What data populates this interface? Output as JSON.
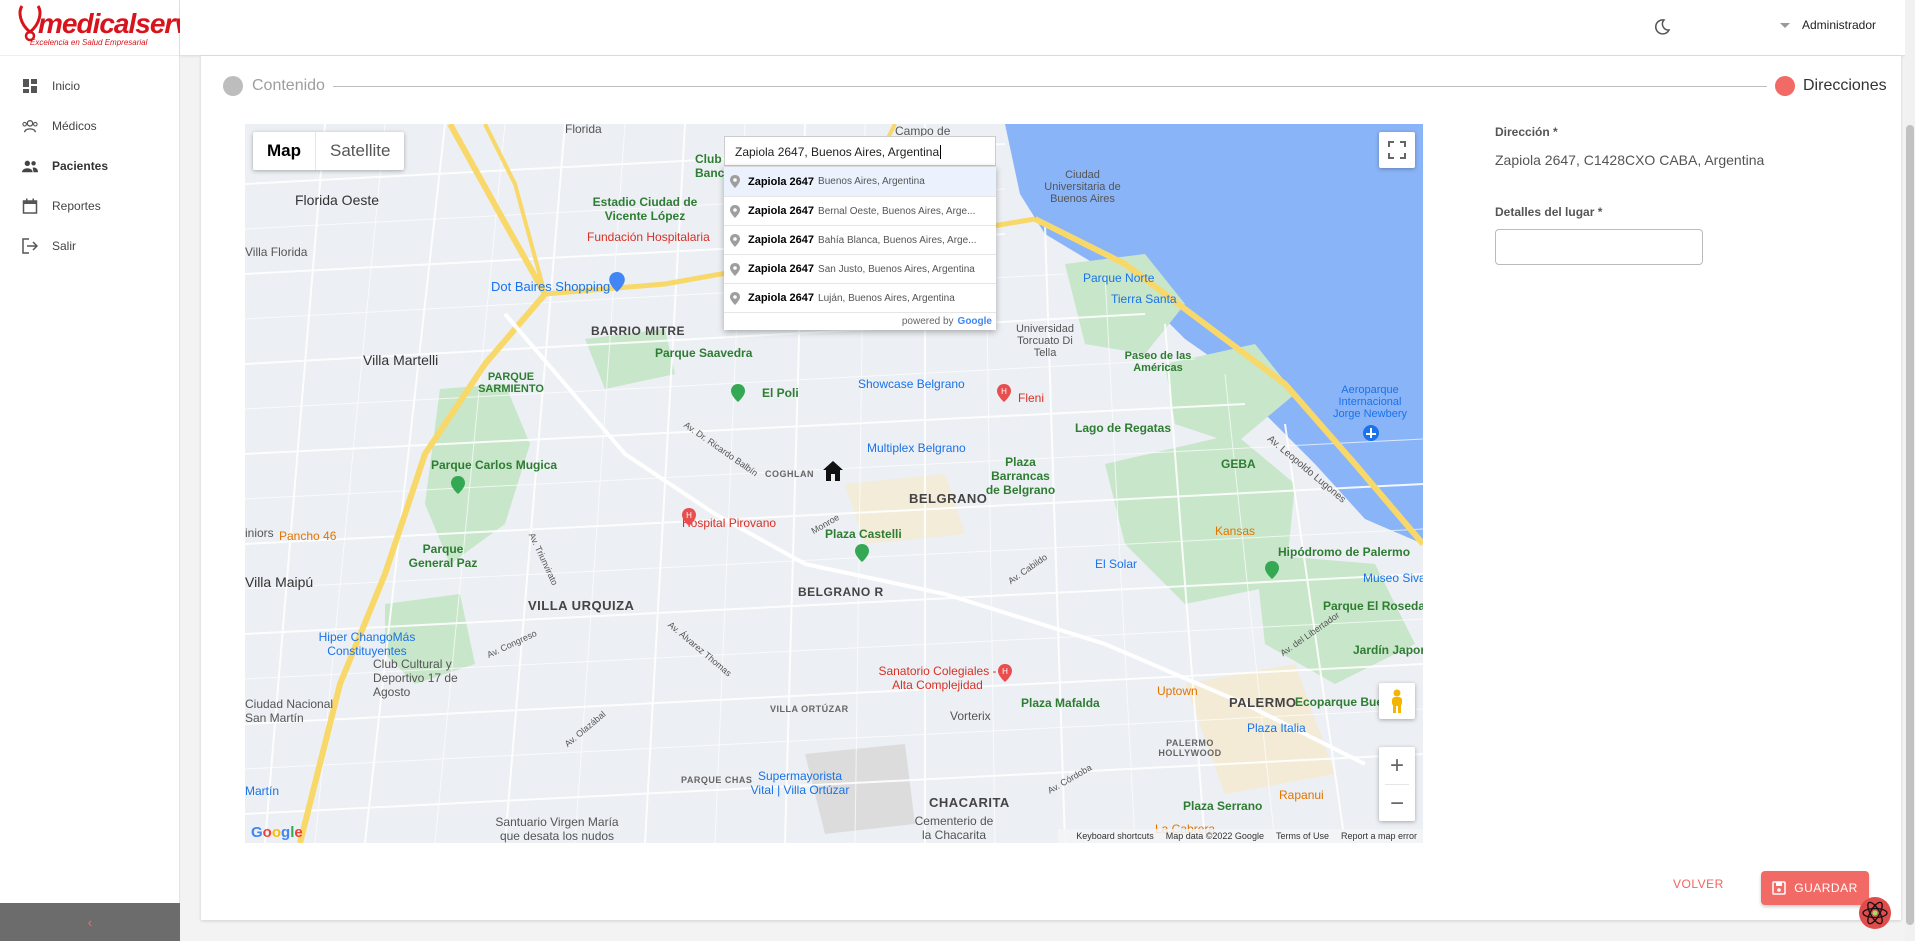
{
  "brand": {
    "name": "medicalservice",
    "tagline": "Excelencia en Salud Empresarial"
  },
  "sidebar": {
    "items": [
      {
        "label": "Inicio",
        "icon": "dashboard-icon"
      },
      {
        "label": "Médicos",
        "icon": "doctors-icon"
      },
      {
        "label": "Pacientes",
        "icon": "patients-icon",
        "active": true
      },
      {
        "label": "Reportes",
        "icon": "calendar-icon"
      },
      {
        "label": "Salir",
        "icon": "logout-icon"
      }
    ],
    "collapse_glyph": "‹"
  },
  "topbar": {
    "user": "Administrador",
    "theme_icon": "moon-icon"
  },
  "stepper": {
    "steps": [
      {
        "label": "Contenido",
        "color": "#bdbdbd"
      },
      {
        "label": "Direcciones",
        "color": "#f26a66"
      }
    ]
  },
  "map": {
    "type_control": {
      "map": "Map",
      "satellite": "Satellite"
    },
    "search_value": "Zapiola 2647, Buenos Aires, Argentina",
    "suggestions": [
      {
        "main": "Zapiola 2647",
        "secondary": "Buenos Aires, Argentina"
      },
      {
        "main": "Zapiola 2647",
        "secondary": "Bernal Oeste, Buenos Aires, Arge..."
      },
      {
        "main": "Zapiola 2647",
        "secondary": "Bahía Blanca, Buenos Aires, Arge..."
      },
      {
        "main": "Zapiola 2647",
        "secondary": "San Justo, Buenos Aires, Argentina"
      },
      {
        "main": "Zapiola 2647",
        "secondary": "Luján, Buenos Aires, Argentina"
      }
    ],
    "powered_by": "powered by",
    "google": "Google",
    "footer": {
      "shortcuts": "Keyboard shortcuts",
      "data": "Map data ©2022 Google",
      "terms": "Terms of Use",
      "report": "Report a map error"
    },
    "labels": {
      "florida": "Florida",
      "florida_oeste": "Florida Oeste",
      "villa_florida": "Villa Florida",
      "villa_martelli": "Villa Martelli",
      "villa_maipu": "Villa Maipú",
      "barrio_mitre": "BARRIO MITRE",
      "parque_sarmiento": "PARQUE SARMIENTO",
      "parque_saavedra": "Parque Saavedra",
      "parque_carlos_mugica": "Parque Carlos Mugica",
      "parque_general_paz": "Parque General Paz",
      "dot_baires": "Dot Baires Shopping",
      "estadio": "Estadio Ciudad de Vicente López",
      "fundacion": "Fundación Hospitalaria",
      "campo": "Campo de",
      "club": "Club Banco",
      "ciudad_universitaria": "Ciudad Universitaria de Buenos Aires",
      "parque_norte": "Parque Norte",
      "tierra_santa": "Tierra Santa",
      "universidad": "Universidad Torcuato Di Tella",
      "paseo_americas": "Paseo de las Américas",
      "aeroparque": "Aeroparque Internacional Jorge Newbery",
      "el_poli": "El Poli",
      "showcase": "Showcase Belgrano",
      "fleni": "Fleni",
      "lago_regatas": "Lago de Regatas",
      "geba": "GEBA",
      "multiplex": "Multiplex Belgrano",
      "coghlan": "COGHLAN",
      "belgrano": "BELGRANO",
      "plaza_barrancas": "Plaza Barrancas de Belgrano",
      "hospital_pirovano": "Hospital Pirovano",
      "plaza_castelli": "Plaza Castelli",
      "kansas": "Kansas",
      "hipodromo": "Hipódromo de Palermo",
      "museo": "Museo Siva",
      "parque_rosedal": "Parque El Rosedal",
      "jardin_japones": "Jardín Japon",
      "pancho": "Pancho 46",
      "villa_urquiza": "VILLA URQUIZA",
      "belgrano_r": "BELGRANO R",
      "el_solar": "El Solar",
      "hiper_chango": "Hiper ChangoMás Constituyentes",
      "sanatorio": "Sanatorio Colegiales - Alta Complejidad",
      "uptown": "Uptown",
      "palermo": "PALERMO",
      "ecoparque": "Ecoparque Bue",
      "club_cultural": "Club Cultural y Deportivo 17 de Agosto",
      "villa_ortuzar": "VILLA ORTÚZAR",
      "vorterix": "Vorterix",
      "plaza_mafalda": "Plaza Mafalda",
      "plaza_italia": "Plaza Italia",
      "palermo_hollywood": "PALERMO HOLLYWOOD",
      "ciudad_nacional": "Ciudad Nacional San Martín",
      "parque_chas": "PARQUE CHAS",
      "supermayorista": "Supermayorista Vital | Villa Ortúzar",
      "chacarita": "CHACARITA",
      "cementerio": "Cementerio de la Chacarita",
      "plaza_serrano": "Plaza Serrano",
      "rapanui": "Rapanui",
      "la_cabrera": "La Cabrera",
      "santuario": "Santuario Virgen María que desata los nudos",
      "martin": "Martín",
      "juniors": "iniors",
      "av_leopoldo": "Av. Leopoldo Lugones",
      "av_ricardo_balbin": "Av. Dr. Ricardo Balbín",
      "av_cabildo": "Av. Cabildo",
      "av_del_libertador": "Av. del Libertador",
      "av_triunvirato": "Av. Triunvirato",
      "av_congreso": "Av. Congreso",
      "av_olazabal": "Av. Olazábal",
      "av_alvarez_thomas": "Av. Álvarez Thomas",
      "av_monroe": "Monroe",
      "av_cordoba": "Av. Córdoba"
    }
  },
  "form": {
    "direccion_label": "Dirección *",
    "direccion_value": "Zapiola 2647, C1428CXO CABA, Argentina",
    "detalles_label": "Detalles del lugar *",
    "detalles_value": ""
  },
  "actions": {
    "volver": "VOLVER",
    "guardar": "GUARDAR"
  },
  "colors": {
    "accent": "#f26a66",
    "brand": "#d8131b",
    "water": "#8ab4f8",
    "park": "#c5e8c5",
    "highway": "#f9d86a"
  }
}
